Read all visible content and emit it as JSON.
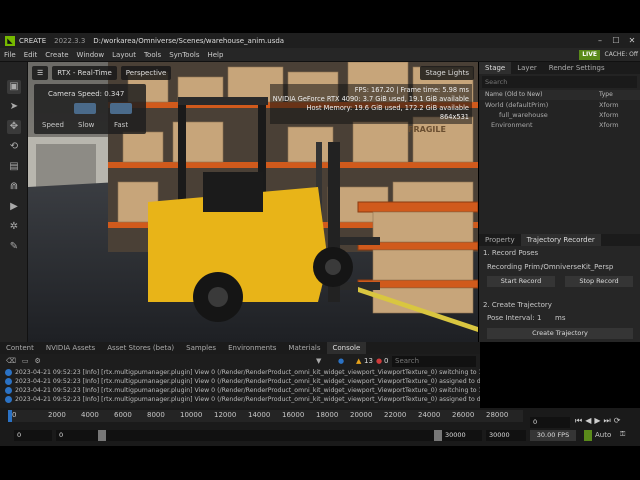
{
  "app": {
    "name": "CREATE",
    "version": "2022.3.3",
    "path": "D:/workarea/Omniverse/Scenes/warehouse_anim.usda",
    "live_label": "LIVE",
    "cache_label": "CACHE: Off"
  },
  "menu": [
    "File",
    "Edit",
    "Create",
    "Window",
    "Layout",
    "Tools",
    "SynTools",
    "Help"
  ],
  "viewport": {
    "render_mode": "RTX - Real-Time",
    "camera": "Perspective",
    "stage_lights": "Stage Lights",
    "camera_speed_label": "Camera Speed:",
    "camera_speed_value": "0.347",
    "speed_label": "Speed",
    "slow_label": "Slow",
    "fast_label": "Fast",
    "stats": [
      "FPS: 167.20  |  Frame time: 5.98 ms",
      "NVIDIA GeForce RTX 4090: 3.7 GiB used, 19.1 GiB available",
      "Host Memory: 19.6 GiB used, 172.2 GiB available",
      "864x531"
    ],
    "box_label": "FRAGILE",
    "colors": {
      "forklift": "#e8b418",
      "shelf": "#d05a1c",
      "floor": "#2a2c30"
    }
  },
  "stage_panel": {
    "tabs": [
      "Stage",
      "Layer",
      "Render Settings"
    ],
    "search_placeholder": "Search",
    "col_name": "Name (Old to New)",
    "col_type": "Type",
    "rows": [
      {
        "name": "World (defaultPrim)",
        "type": "Xform"
      },
      {
        "name": "full_warehouse",
        "type": "Xform"
      },
      {
        "name": "Environment",
        "type": "Xform"
      }
    ]
  },
  "recorder": {
    "tabs": [
      "Property",
      "Trajectory Recorder"
    ],
    "section1": "1. Record Poses",
    "recording_prim_label": "Recording Prim:",
    "recording_prim_value": "/OmniverseKit_Persp",
    "start_record": "Start Record",
    "stop_record": "Stop Record",
    "section2": "2. Create Trajectory",
    "pose_interval_label": "Pose Interval:",
    "pose_interval_value": "1",
    "pose_interval_unit": "ms",
    "create_trajectory": "Create Trajectory"
  },
  "bottom_tabs": [
    "Content",
    "NVIDIA Assets",
    "Asset Stores (beta)",
    "Samples",
    "Environments",
    "Materials",
    "Console"
  ],
  "console": {
    "search_placeholder": "Search",
    "warning_count": "13",
    "error_count": "0",
    "lines": [
      "2023-04-21 09:52:23  [Info] [rtx.multigpumanager.plugin] View 0 (/Render/RenderProduct_omni_kit_widget_viewport_ViewportTexture_0) switching to 1x",
      "2023-04-21 09:52:23  [Info] [rtx.multigpumanager.plugin] View 0 (/Render/RenderProduct_omni_kit_widget_viewport_ViewportTexture_0) assigned to dev",
      "2023-04-21 09:52:23  [Info] [rtx.multigpumanager.plugin] View 0 (/Render/RenderProduct_omni_kit_widget_viewport_ViewportTexture_0) switching to 1x",
      "2023-04-21 09:52:23  [Info] [rtx.multigpumanager.plugin] View 0 (/Render/RenderProduct_omni_kit_widget_viewport_ViewportTexture_0) assigned to dev"
    ]
  },
  "timeline": {
    "ticks": [
      "0",
      "2000",
      "4000",
      "6000",
      "8000",
      "10000",
      "12000",
      "14000",
      "16000",
      "18000",
      "20000",
      "22000",
      "24000",
      "26000",
      "28000"
    ],
    "current_frame": "0",
    "start": "0",
    "range_start": "0",
    "range_end": "30000",
    "end": "30000",
    "fps": "30.00 FPS",
    "auto": "Auto"
  }
}
